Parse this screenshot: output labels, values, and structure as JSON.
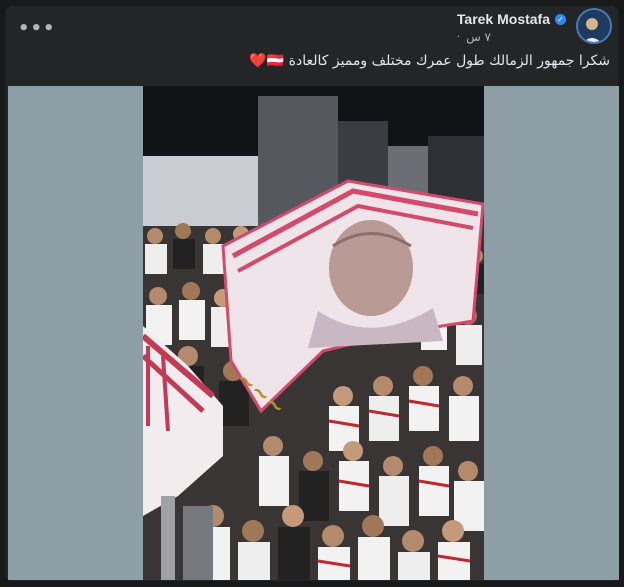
{
  "post": {
    "author": "Tarek Mostafa",
    "time": "٧ س",
    "caption": "شكرا جمهور الزمالك طول عمرك مختلف ومميز كالعادة 🇦🇹❤️",
    "more_label": "•••"
  },
  "icons": {
    "verified": "✓",
    "globe": "⚙"
  }
}
